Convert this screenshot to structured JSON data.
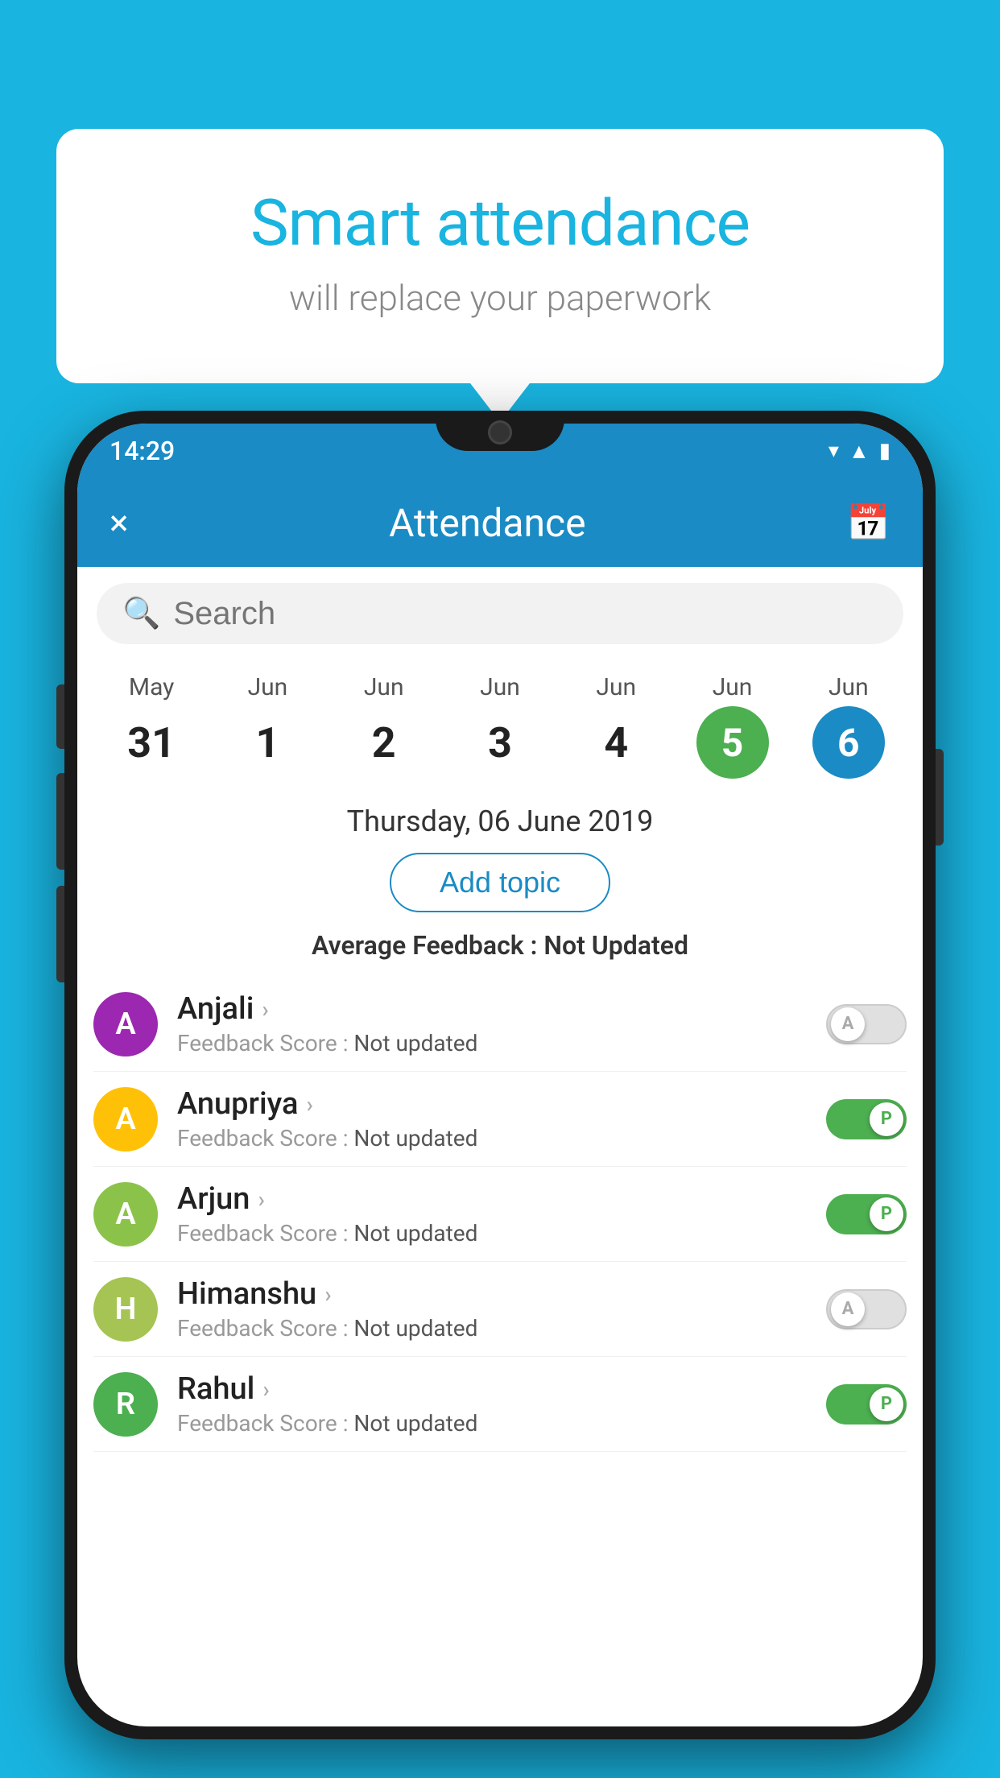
{
  "background_color": "#19b4e0",
  "speech_bubble": {
    "title": "Smart attendance",
    "subtitle": "will replace your paperwork"
  },
  "status_bar": {
    "time": "14:29",
    "icons": [
      "wifi",
      "signal",
      "battery"
    ]
  },
  "app_bar": {
    "title": "Attendance",
    "close_label": "×",
    "calendar_label": "📅"
  },
  "search": {
    "placeholder": "Search"
  },
  "calendar": {
    "days": [
      {
        "month": "May",
        "date": "31",
        "style": "normal"
      },
      {
        "month": "Jun",
        "date": "1",
        "style": "normal"
      },
      {
        "month": "Jun",
        "date": "2",
        "style": "normal"
      },
      {
        "month": "Jun",
        "date": "3",
        "style": "normal"
      },
      {
        "month": "Jun",
        "date": "4",
        "style": "normal"
      },
      {
        "month": "Jun",
        "date": "5",
        "style": "today"
      },
      {
        "month": "Jun",
        "date": "6",
        "style": "selected"
      }
    ]
  },
  "selected_date": "Thursday, 06 June 2019",
  "add_topic_label": "Add topic",
  "avg_feedback": {
    "label": "Average Feedback : ",
    "value": "Not Updated"
  },
  "students": [
    {
      "name": "Anjali",
      "initial": "A",
      "avatar_color": "#9c27b0",
      "score_label": "Feedback Score : ",
      "score_value": "Not updated",
      "toggle": "off",
      "toggle_letter": "A"
    },
    {
      "name": "Anupriya",
      "initial": "A",
      "avatar_color": "#ffc107",
      "score_label": "Feedback Score : ",
      "score_value": "Not updated",
      "toggle": "on",
      "toggle_letter": "P"
    },
    {
      "name": "Arjun",
      "initial": "A",
      "avatar_color": "#8bc34a",
      "score_label": "Feedback Score : ",
      "score_value": "Not updated",
      "toggle": "on",
      "toggle_letter": "P"
    },
    {
      "name": "Himanshu",
      "initial": "H",
      "avatar_color": "#a5c453",
      "score_label": "Feedback Score : ",
      "score_value": "Not updated",
      "toggle": "off",
      "toggle_letter": "A"
    },
    {
      "name": "Rahul",
      "initial": "R",
      "avatar_color": "#4caf50",
      "score_label": "Feedback Score : ",
      "score_value": "Not updated",
      "toggle": "on",
      "toggle_letter": "P"
    }
  ]
}
